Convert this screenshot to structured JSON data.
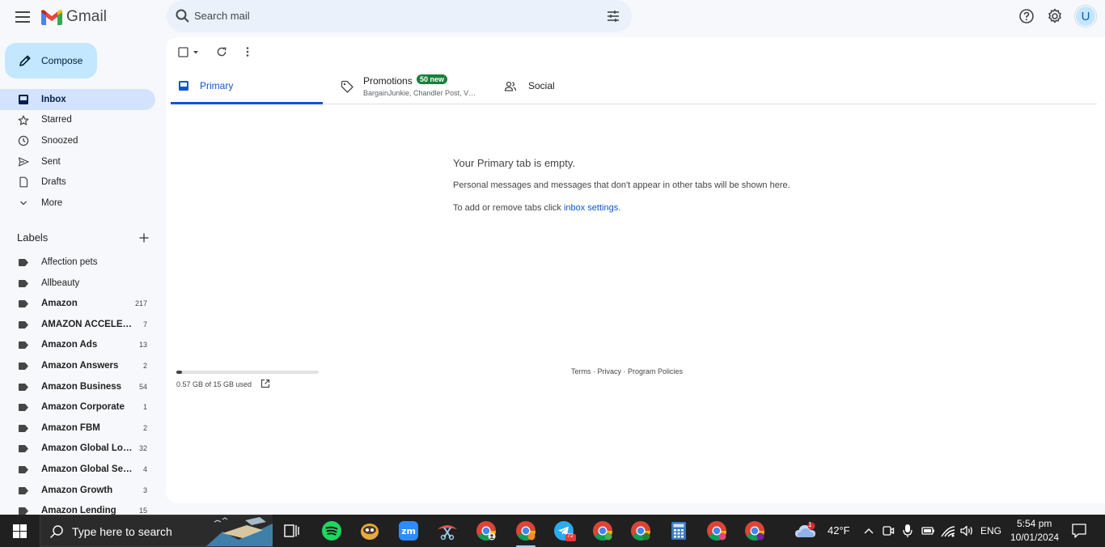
{
  "header": {
    "app_name": "Gmail",
    "search_placeholder": "Search mail",
    "avatar_letter": "U"
  },
  "compose_label": "Compose",
  "nav": [
    {
      "label": "Inbox",
      "icon": "inbox-icon",
      "active": true
    },
    {
      "label": "Starred",
      "icon": "star-icon"
    },
    {
      "label": "Snoozed",
      "icon": "clock-icon"
    },
    {
      "label": "Sent",
      "icon": "send-icon"
    },
    {
      "label": "Drafts",
      "icon": "draft-icon"
    },
    {
      "label": "More",
      "icon": "chevron-down-icon"
    }
  ],
  "labels_heading": "Labels",
  "labels": [
    {
      "name": "Affection pets",
      "count": "",
      "bold": false
    },
    {
      "name": "Allbeauty",
      "count": "",
      "bold": false
    },
    {
      "name": "Amazon",
      "count": "217",
      "bold": true
    },
    {
      "name": "AMAZON ACCELER…",
      "count": "7",
      "bold": true
    },
    {
      "name": "Amazon Ads",
      "count": "13",
      "bold": true
    },
    {
      "name": "Amazon Answers",
      "count": "2",
      "bold": true
    },
    {
      "name": "Amazon Business",
      "count": "54",
      "bold": true
    },
    {
      "name": "Amazon Corporate",
      "count": "1",
      "bold": true
    },
    {
      "name": "Amazon FBM",
      "count": "2",
      "bold": true
    },
    {
      "name": "Amazon Global Lo…",
      "count": "32",
      "bold": true
    },
    {
      "name": "Amazon Global Sell…",
      "count": "4",
      "bold": true
    },
    {
      "name": "Amazon Growth",
      "count": "3",
      "bold": true
    },
    {
      "name": "Amazon Lending",
      "count": "15",
      "bold": true
    }
  ],
  "tabs": {
    "primary": "Primary",
    "promotions": "Promotions",
    "promotions_badge": "50 new",
    "promotions_senders": "BargainJunkie, Chandler Post, V…",
    "social": "Social"
  },
  "empty_state": {
    "title": "Your Primary tab is empty.",
    "description": "Personal messages and messages that don't appear in other tabs will be shown here.",
    "settings_prefix": "To add or remove tabs click ",
    "settings_link": "inbox settings",
    "settings_suffix": "."
  },
  "storage": {
    "used_text": "0.57 GB of 15 GB used",
    "fraction_used": 0.038
  },
  "footer_links": "Terms · Privacy · Program Policies",
  "taskbar": {
    "search_placeholder": "Type here to search",
    "weather_temp": "42°F",
    "weather_alert": "1",
    "language": "ENG",
    "time": "5:54 pm",
    "date": "10/01/2024",
    "telegram_badge": "72",
    "apps": [
      {
        "icon": "task-view-icon"
      },
      {
        "icon": "spotify-icon"
      },
      {
        "icon": "game-icon"
      },
      {
        "icon": "zoom-icon"
      },
      {
        "icon": "snipping-tool-icon"
      },
      {
        "icon": "chrome-icon"
      },
      {
        "icon": "chrome-icon"
      },
      {
        "icon": "telegram-icon"
      },
      {
        "icon": "chrome-icon"
      },
      {
        "icon": "chrome-icon"
      },
      {
        "icon": "calculator-icon"
      },
      {
        "icon": "chrome-icon"
      },
      {
        "icon": "chrome-icon"
      }
    ]
  },
  "colors": {
    "accent": "#0b57d0",
    "compose_bg": "#c2e7ff",
    "active_nav_bg": "#d3e3fd",
    "badge_green": "#188038",
    "taskbar_bg": "#202020"
  }
}
